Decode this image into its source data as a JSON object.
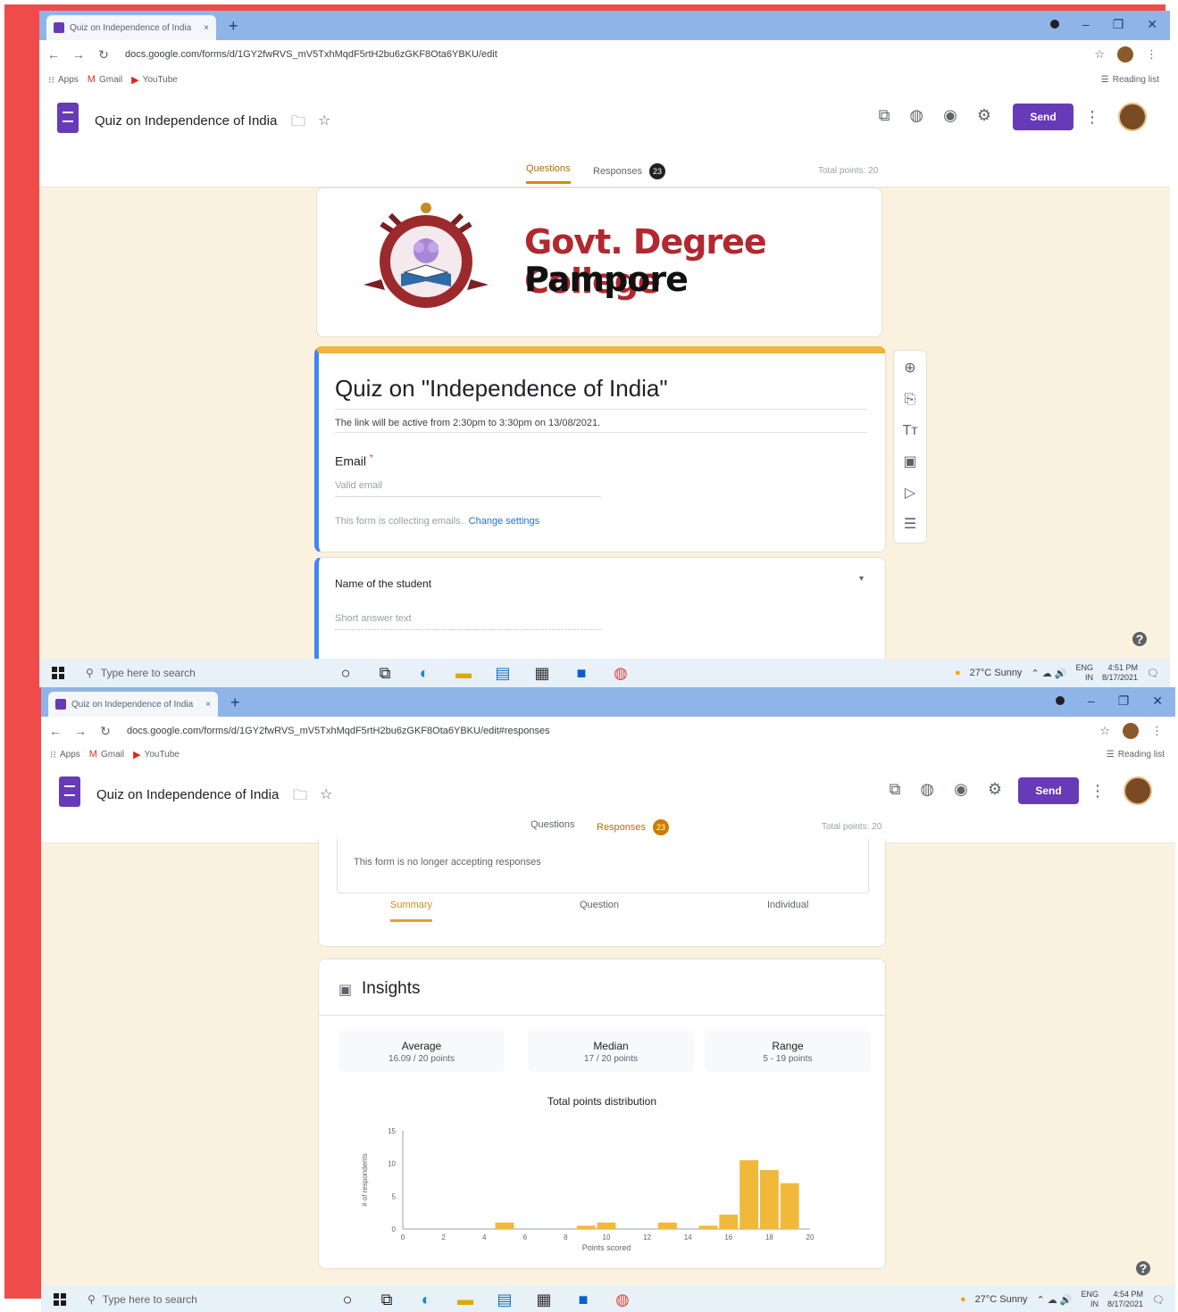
{
  "browser": {
    "tab_title": "Quiz on Independence of India",
    "tab_close": "×",
    "new_tab": "+",
    "url_1": "docs.google.com/forms/d/1GY2fwRVS_mV5TxhMqdF5rtH2bu6zGKF8Ota6YBKU/edit",
    "url_2": "docs.google.com/forms/d/1GY2fwRVS_mV5TxhMqdF5rtH2bu6zGKF8Ota6YBKU/edit#responses",
    "bookmarks": [
      "Apps",
      "Gmail",
      "YouTube"
    ],
    "reading_list": "Reading list"
  },
  "form": {
    "doc_title": "Quiz on Independence of India",
    "send_label": "Send",
    "tab_questions": "Questions",
    "tab_responses": "Responses",
    "responses_count": "23",
    "total_points": "Total points: 20"
  },
  "header_image": {
    "line1": "Govt. Degree College",
    "line2": "Pampore"
  },
  "quiz": {
    "title": "Quiz on \"Independence of India\"",
    "description": "The link will be active from 2:30pm to 3:30pm on 13/08/2021.",
    "email_label": "Email",
    "email_required": "*",
    "email_placeholder": "Valid email",
    "collecting_text": "This form is collecting emails.",
    "change_settings": "Change settings",
    "question1": "Name of the student",
    "question1_placeholder": "Short answer text"
  },
  "responses": {
    "not_accepting": "This form is no longer accepting responses",
    "sub_tabs": [
      "Summary",
      "Question",
      "Individual"
    ],
    "insights_title": "Insights",
    "stats": [
      {
        "label": "Average",
        "value": "16.09 / 20 points"
      },
      {
        "label": "Median",
        "value": "17 / 20 points"
      },
      {
        "label": "Range",
        "value": "5 - 19 points"
      }
    ]
  },
  "chart_data": {
    "type": "bar",
    "title": "Total points distribution",
    "xlabel": "Points scored",
    "ylabel": "# of respondents",
    "x": [
      0,
      1,
      2,
      3,
      4,
      5,
      6,
      7,
      8,
      9,
      10,
      11,
      12,
      13,
      14,
      15,
      16,
      17,
      18,
      19,
      20
    ],
    "values": [
      0,
      0,
      0,
      0,
      0,
      1,
      0,
      0,
      0,
      0.5,
      1,
      0,
      0,
      1,
      0,
      0.5,
      2.2,
      10.5,
      9,
      7,
      0
    ],
    "xticks": [
      "0",
      "2",
      "4",
      "6",
      "8",
      "10",
      "12",
      "14",
      "16",
      "18",
      "20"
    ],
    "yticks": [
      "0",
      "5",
      "10",
      "15"
    ],
    "ylim": [
      0,
      15
    ],
    "bar_color": "#f0b93a"
  },
  "taskbar": {
    "search": "Type here to search",
    "weather": "27°C Sunny",
    "lang": "ENG",
    "lang2": "IN",
    "time_1": "4:51 PM",
    "time_2": "4:54 PM",
    "date": "8/17/2021"
  }
}
